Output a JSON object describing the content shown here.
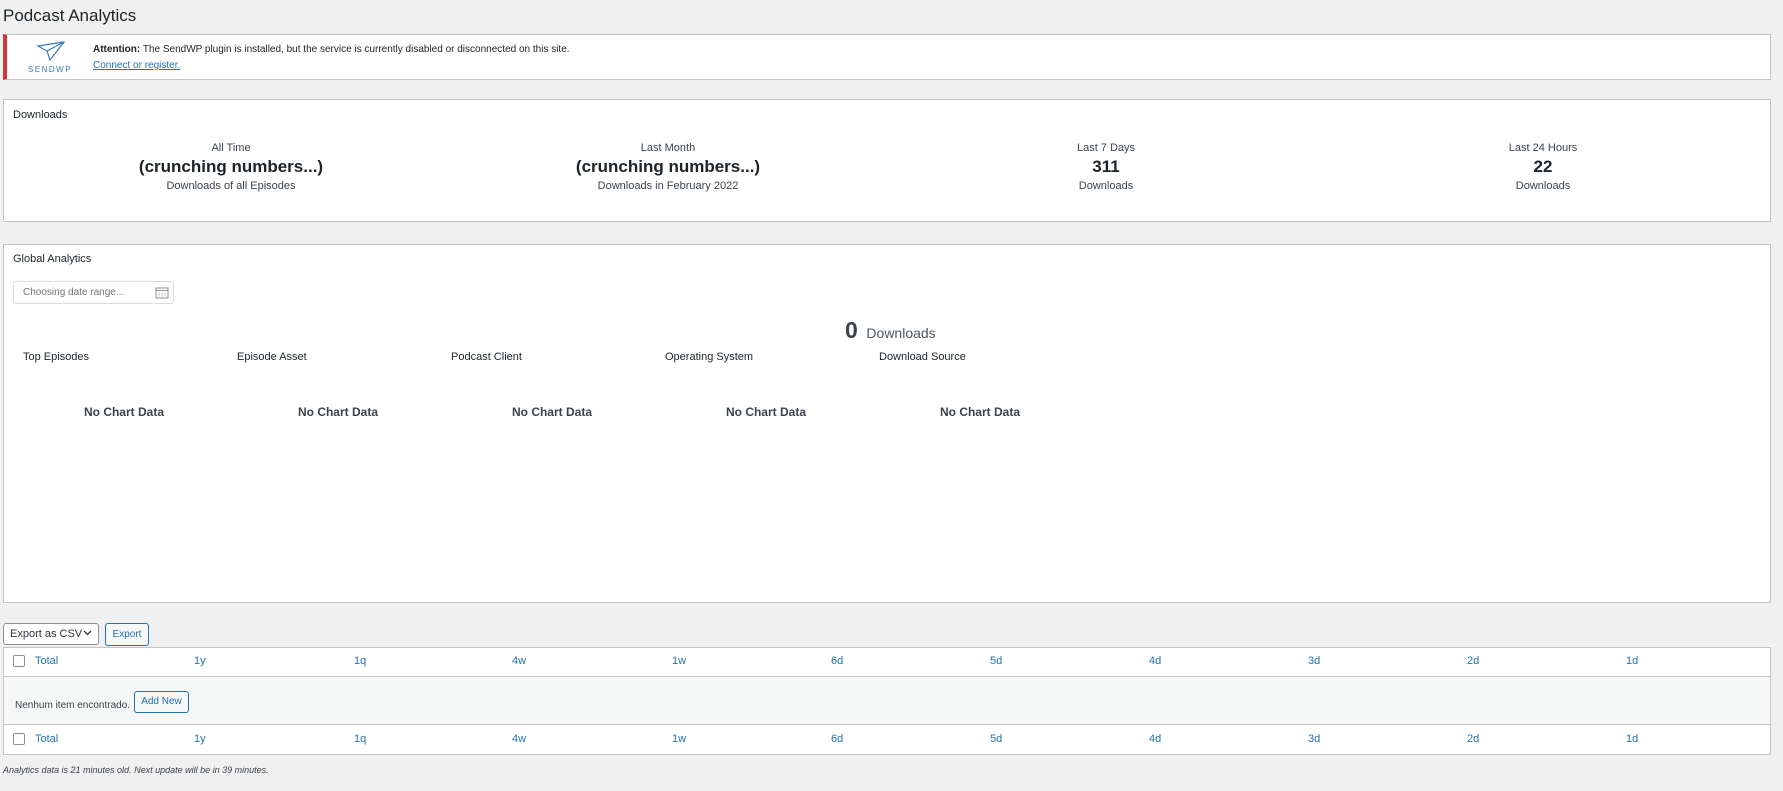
{
  "page": {
    "title": "Podcast Analytics"
  },
  "notice": {
    "logo_text": "SENDWP",
    "attention_label": "Attention:",
    "message": "The SendWP plugin is installed, but the service is currently disabled or disconnected on this site.",
    "link": "Connect or register."
  },
  "downloads": {
    "title": "Downloads",
    "stats": [
      {
        "label": "All Time",
        "value": "(crunching numbers...)",
        "sub": "Downloads of all Episodes"
      },
      {
        "label": "Last Month",
        "value": "(crunching numbers...)",
        "sub": "Downloads in February 2022"
      },
      {
        "label": "Last 7 Days",
        "value": "311",
        "sub": "Downloads"
      },
      {
        "label": "Last 24 Hours",
        "value": "22",
        "sub": "Downloads"
      }
    ]
  },
  "global": {
    "title": "Global Analytics",
    "date_placeholder": "Choosing date range...",
    "total_value": "0",
    "total_label": "Downloads",
    "charts": [
      {
        "title": "Top Episodes",
        "empty": "No Chart Data"
      },
      {
        "title": "Episode Asset",
        "empty": "No Chart Data"
      },
      {
        "title": "Podcast Client",
        "empty": "No Chart Data"
      },
      {
        "title": "Operating System",
        "empty": "No Chart Data"
      },
      {
        "title": "Download Source",
        "empty": "No Chart Data"
      }
    ]
  },
  "export": {
    "select_value": "Export as CSV",
    "button": "Export"
  },
  "table": {
    "columns": [
      "Total",
      "1y",
      "1q",
      "4w",
      "1w",
      "6d",
      "5d",
      "4d",
      "3d",
      "2d",
      "1d"
    ],
    "empty_message": "Nenhum item encontrado.",
    "add_new": "Add New"
  },
  "footer": {
    "note": "Analytics data is 21 minutes old. Next update will be in 39 minutes."
  },
  "colors": {
    "accent": "#2271b1",
    "error": "#d63638",
    "background": "#f0f0f1"
  },
  "icons": [
    "sendwp-logo",
    "calendar-icon",
    "chevron-down-icon"
  ]
}
